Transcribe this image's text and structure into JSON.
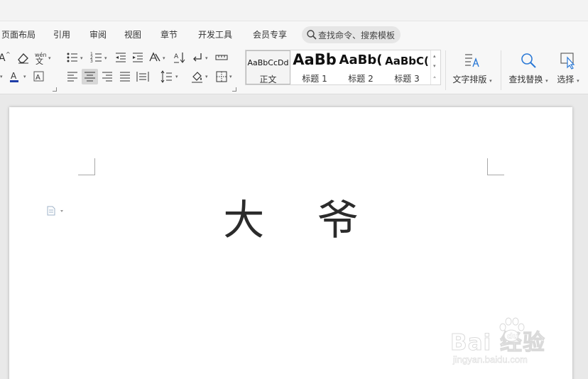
{
  "menu": {
    "items": [
      "页面布局",
      "引用",
      "审阅",
      "视图",
      "章节",
      "开发工具",
      "会员专享"
    ],
    "search_placeholder": "查找命令、搜索模板"
  },
  "ribbon": {
    "styles": [
      {
        "sample": "AaBbCcDd",
        "name": "正文",
        "selected": true
      },
      {
        "sample": "AaBb",
        "name": "标题 1"
      },
      {
        "sample": "AaBb(",
        "name": "标题 2"
      },
      {
        "sample": "AaBbC(",
        "name": "标题 3"
      }
    ],
    "text_layout_label": "文字排版",
    "find_replace_label": "查找替换",
    "select_label": "选择",
    "font_color": "#1f3ea8",
    "selected_button_bg": "#d7d7d7"
  },
  "document": {
    "title": "大 爷"
  },
  "watermark": {
    "brand": "Bai  经验",
    "url": "jingyan.baidu.com"
  }
}
